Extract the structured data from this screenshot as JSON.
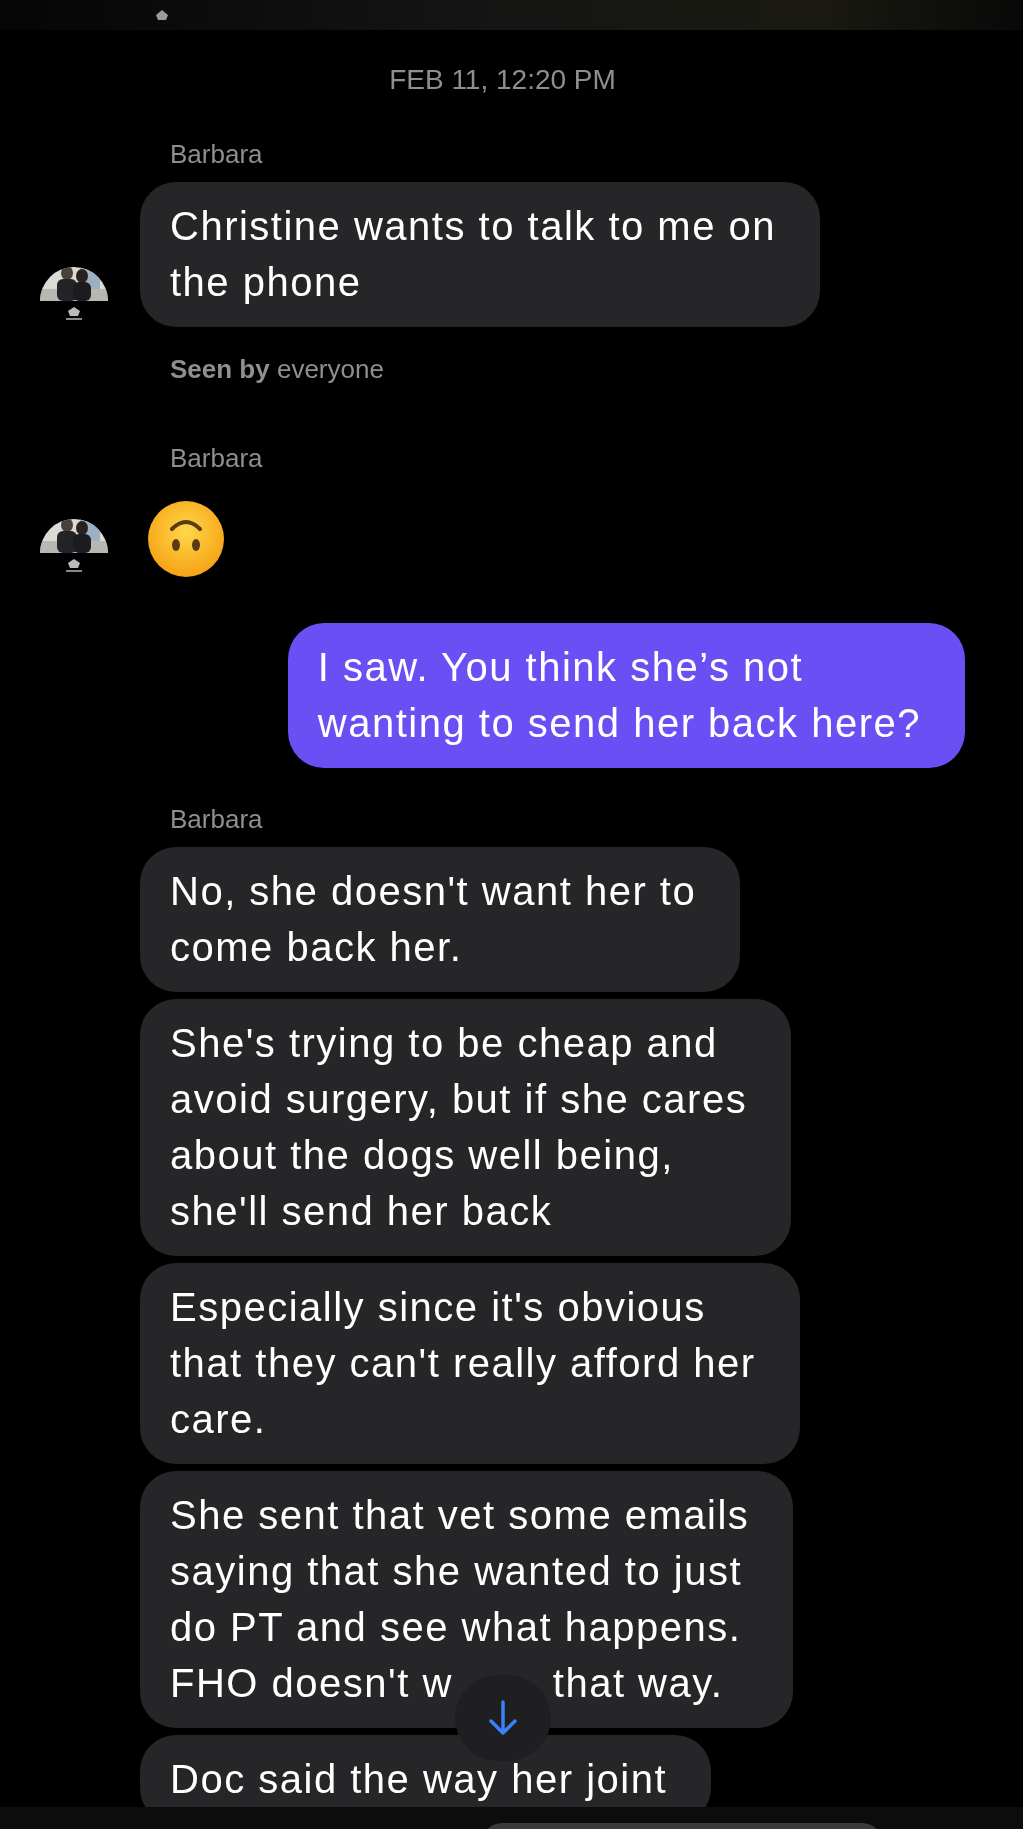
{
  "conversation": [
    {
      "kind": "timestamp",
      "text": "FEB 11, 12:20 PM"
    },
    {
      "kind": "sender",
      "text": "Barbara"
    },
    {
      "kind": "incoming",
      "lines": [
        "Christine wants to talk to me on",
        "the phone"
      ],
      "avatar": true
    },
    {
      "kind": "receipt",
      "label": "Seen by",
      "text": "everyone"
    },
    {
      "kind": "sender",
      "text": "Barbara"
    },
    {
      "kind": "emoji",
      "avatar": true
    },
    {
      "kind": "outgoing",
      "lines": [
        "I saw. You think she’s not",
        "wanting to send her back here?"
      ]
    },
    {
      "kind": "sender",
      "text": "Barbara"
    },
    {
      "kind": "incoming",
      "lines": [
        "No, she doesn't want her to",
        "come back her."
      ],
      "avatar": false
    },
    {
      "kind": "incoming",
      "lines": [
        "She's trying to be cheap and",
        "avoid surgery, but if she cares",
        "about the dogs well being,",
        "she'll send her back"
      ],
      "avatar": false
    },
    {
      "kind": "incoming",
      "lines": [
        "Especially since it's obvious",
        "that they can't really afford her",
        "care."
      ],
      "avatar": false
    },
    {
      "kind": "incoming",
      "lines": [
        "She sent that vet some emails",
        "saying that she wanted to just",
        "do PT and see what happens."
      ],
      "cut_line": "FHO doesn't w",
      "cut_after": "that way.",
      "avatar": false
    },
    {
      "kind": "incoming",
      "lines": [
        "Doc said the way her joint"
      ],
      "avatar": false
    }
  ]
}
